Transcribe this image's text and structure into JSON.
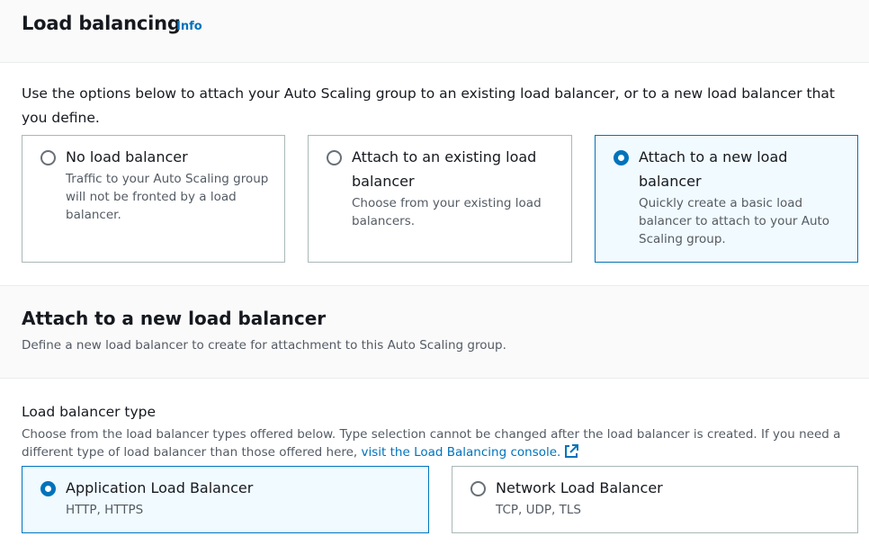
{
  "section1": {
    "title": "Load balancing",
    "info_link": "Info",
    "description": "Use the options below to attach your Auto Scaling group to an existing load balancer, or to a new load balancer that you define.",
    "options": [
      {
        "label": "No load balancer",
        "description": "Traffic to your Auto Scaling group will not be fronted by a load balancer.",
        "selected": false
      },
      {
        "label": "Attach to an existing load balancer",
        "description": "Choose from your existing load balancers.",
        "selected": false
      },
      {
        "label": "Attach to a new load balancer",
        "description": "Quickly create a basic load balancer to attach to your Auto Scaling group.",
        "selected": true
      }
    ]
  },
  "section2": {
    "title": "Attach to a new load balancer",
    "description": "Define a new load balancer to create for attachment to this Auto Scaling group."
  },
  "lb_type": {
    "label": "Load balancer type",
    "description_text": "Choose from the load balancer types offered below. Type selection cannot be changed after the load balancer is created. If you need a different type of load balancer than those offered here, ",
    "link_text": "visit the Load Balancing console.",
    "options": [
      {
        "label": "Application Load Balancer",
        "description": "HTTP, HTTPS",
        "selected": true
      },
      {
        "label": "Network Load Balancer",
        "description": "TCP, UDP, TLS",
        "selected": false
      }
    ]
  },
  "colors": {
    "accent": "#0073bb",
    "selected_bg": "#f1faff",
    "border": "#aab7b8",
    "text_secondary": "#545b64"
  }
}
